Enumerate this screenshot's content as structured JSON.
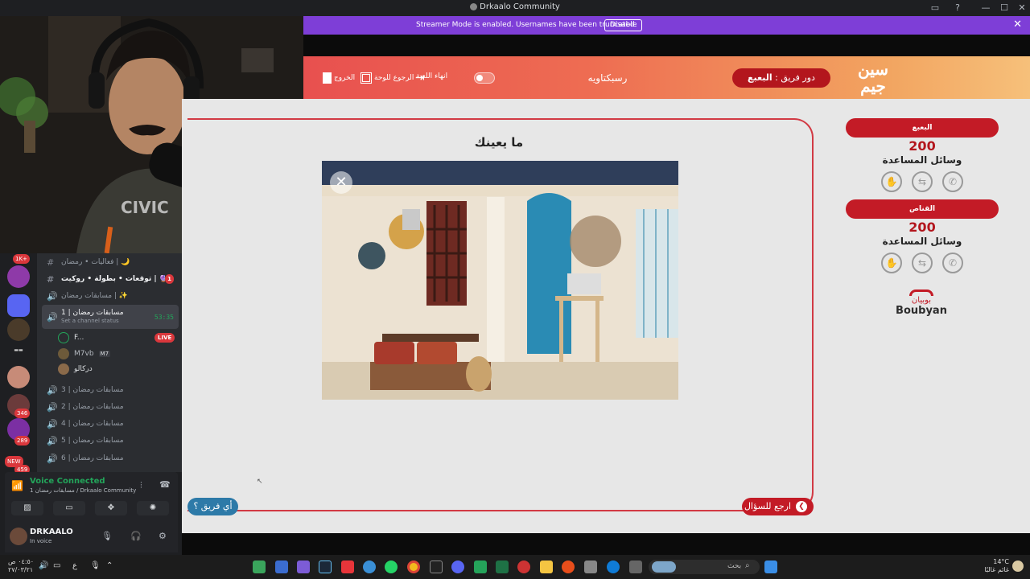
{
  "window": {
    "title": "Drkaalo Community",
    "controls": {
      "minimize": "—",
      "maximize": "☐",
      "close": "✕"
    }
  },
  "streamer_banner": {
    "message": "Streamer Mode is enabled. Usernames have been truncated.",
    "disable_label": "Disable",
    "close": "✕"
  },
  "game": {
    "logo_text": "سين\nجيم",
    "turn_prefix": "دور فريق : ",
    "turn_team": "البعبع",
    "team_name_header": "رسبكتاويه",
    "header_actions": {
      "end_game": "انهاء اللعبة",
      "back_to_board": "الرجوع للوحة",
      "exit": "الخروج"
    },
    "question_title": "ما يعينك",
    "close_symbol": "✕",
    "back_to_question": "ارجع للسؤال",
    "which_team": "أي فريق ؟",
    "teams": [
      {
        "name": "البعبع",
        "score": "200",
        "aids_label": "وسائل المساعدة"
      },
      {
        "name": "القناص",
        "score": "200",
        "aids_label": "وسائل المساعدة"
      }
    ],
    "sponsor": {
      "arabic": "بوبيان",
      "english": "Boubyan"
    }
  },
  "discord": {
    "server_badges": [
      "1K+",
      "346",
      "289",
      "459"
    ],
    "new_badge": "NEW",
    "channels": [
      {
        "label": "فعاليات • رمضان | 🌙",
        "type": "text"
      },
      {
        "label": "توقعات • بطولة • روكيت | 🔮",
        "type": "text",
        "badge": "1"
      },
      {
        "label": "مسابقات رمضان | ✨",
        "type": "voice"
      },
      {
        "label": "مسابقات رمضان | 1",
        "type": "voice",
        "active": true,
        "time": "53:35",
        "status": "Set a channel status"
      },
      {
        "label": "مسابقات رمضان | 3",
        "type": "voice"
      },
      {
        "label": "مسابقات رمضان | 2",
        "type": "voice"
      },
      {
        "label": "مسابقات رمضان | 4",
        "type": "voice"
      },
      {
        "label": "مسابقات رمضان | 5",
        "type": "voice"
      },
      {
        "label": "مسابقات رمضان | 6",
        "type": "voice"
      }
    ],
    "members": [
      {
        "name": "F...",
        "live": "LIVE"
      },
      {
        "name": "M7vb",
        "tag": "M7"
      },
      {
        "name": "دركالو"
      }
    ],
    "voice": {
      "status": "Voice Connected",
      "channel": "1 مسابقات رمضان / Drkaalo Community"
    },
    "user": {
      "name": "DRKAALO",
      "status": "In voice"
    }
  },
  "taskbar": {
    "search_placeholder": "بحث",
    "weather": "14°C",
    "weather_desc": "غائم غالبًا",
    "time": "٠٤:٥٠ ص",
    "date": "٢٧/٠٣/٢١",
    "lang": "ع"
  }
}
